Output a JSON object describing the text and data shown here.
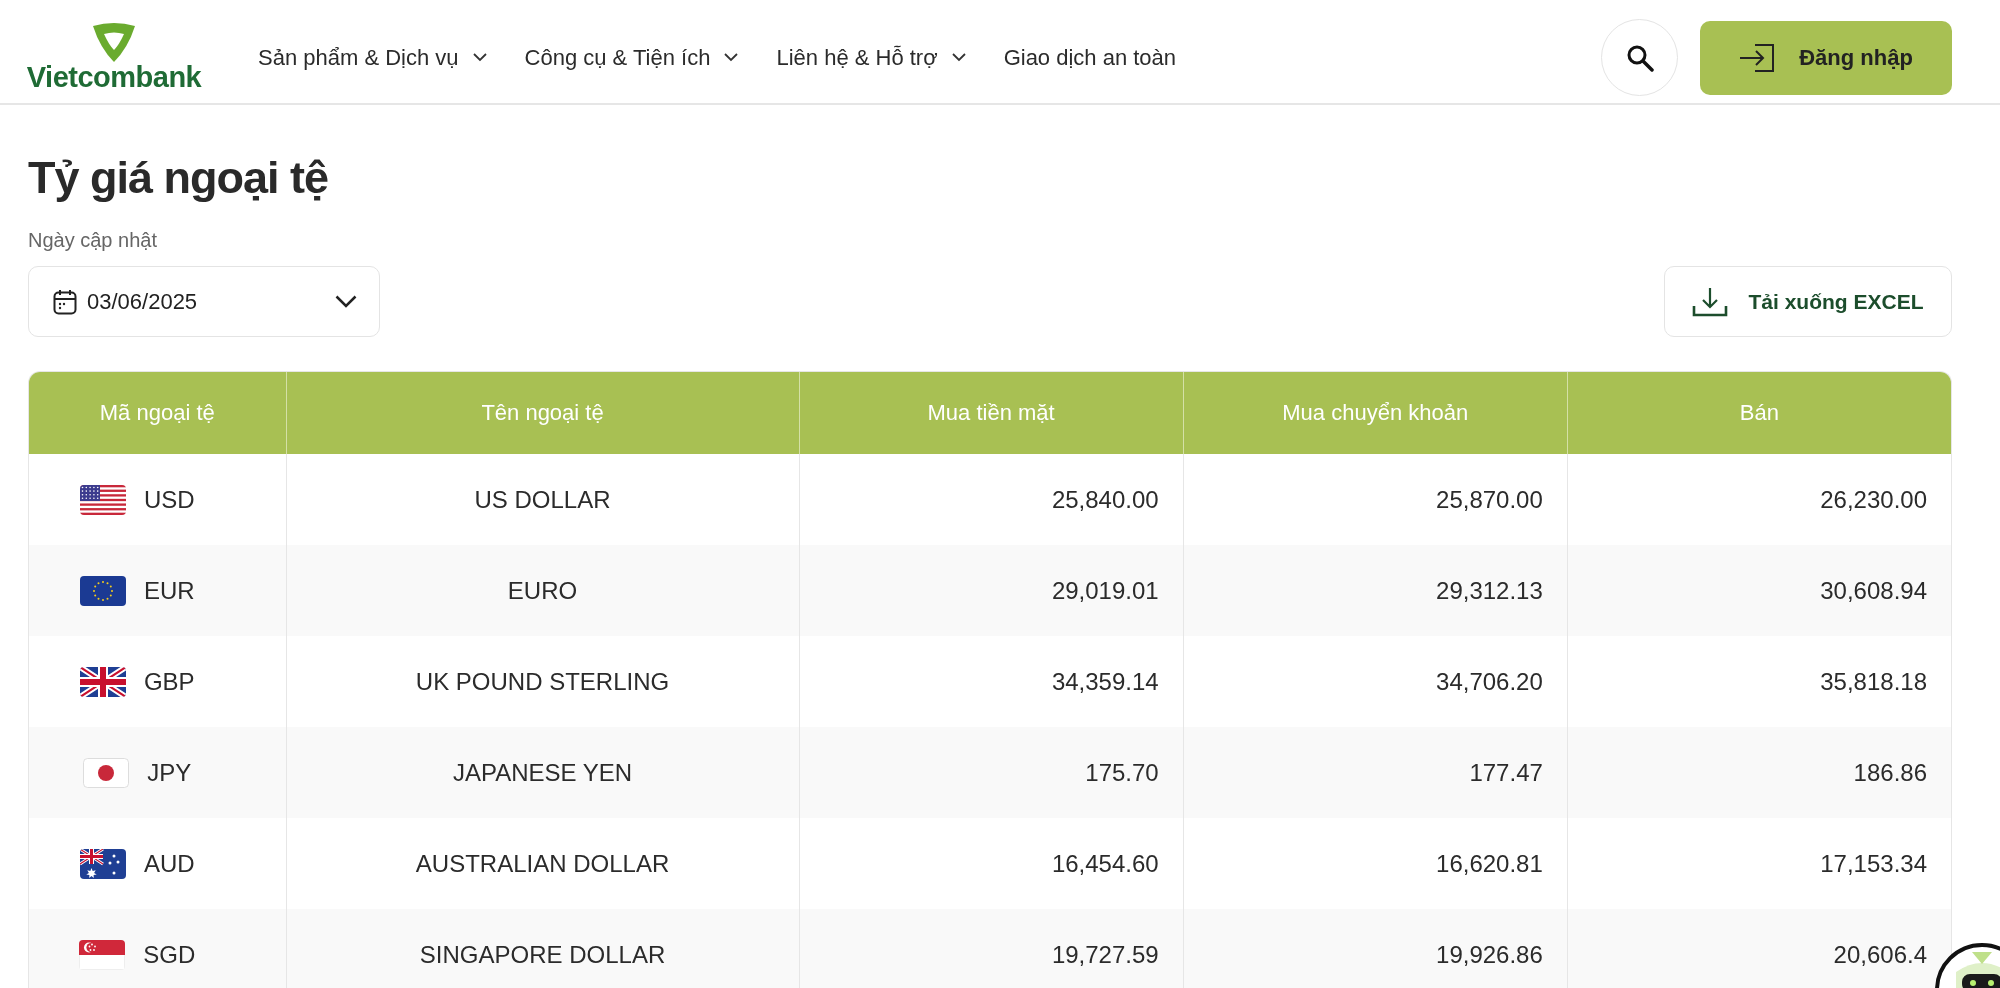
{
  "header": {
    "logo": "Vietcombank",
    "nav": [
      {
        "label": "Sản phẩm & Dịch vụ",
        "has_dropdown": true
      },
      {
        "label": "Công cụ & Tiện ích",
        "has_dropdown": true
      },
      {
        "label": "Liên hệ & Hỗ trợ",
        "has_dropdown": true
      },
      {
        "label": "Giao dịch an toàn",
        "has_dropdown": false
      }
    ],
    "login_button": "Đăng nhập"
  },
  "page": {
    "title": "Tỷ giá ngoại tệ",
    "date_label": "Ngày cập nhật",
    "date_value": "03/06/2025",
    "download_button": "Tải xuống EXCEL"
  },
  "table": {
    "columns": [
      "Mã ngoại tệ",
      "Tên ngoại tệ",
      "Mua tiền mặt",
      "Mua chuyển khoản",
      "Bán"
    ],
    "rows": [
      {
        "kind": "us",
        "code": "USD",
        "name": "US DOLLAR",
        "buy_cash": "25,840.00",
        "buy_transfer": "25,870.00",
        "sell": "26,230.00"
      },
      {
        "kind": "eu",
        "code": "EUR",
        "name": "EURO",
        "buy_cash": "29,019.01",
        "buy_transfer": "29,312.13",
        "sell": "30,608.94"
      },
      {
        "kind": "gb",
        "code": "GBP",
        "name": "UK POUND STERLING",
        "buy_cash": "34,359.14",
        "buy_transfer": "34,706.20",
        "sell": "35,818.18"
      },
      {
        "kind": "jp",
        "code": "JPY",
        "name": "JAPANESE YEN",
        "buy_cash": "175.70",
        "buy_transfer": "177.47",
        "sell": "186.86"
      },
      {
        "kind": "au",
        "code": "AUD",
        "name": "AUSTRALIAN DOLLAR",
        "buy_cash": "16,454.60",
        "buy_transfer": "16,620.81",
        "sell": "17,153.34"
      },
      {
        "kind": "sg",
        "code": "SGD",
        "name": "SINGAPORE DOLLAR",
        "buy_cash": "19,727.59",
        "buy_transfer": "19,926.86",
        "sell": "20,606.4"
      }
    ]
  }
}
